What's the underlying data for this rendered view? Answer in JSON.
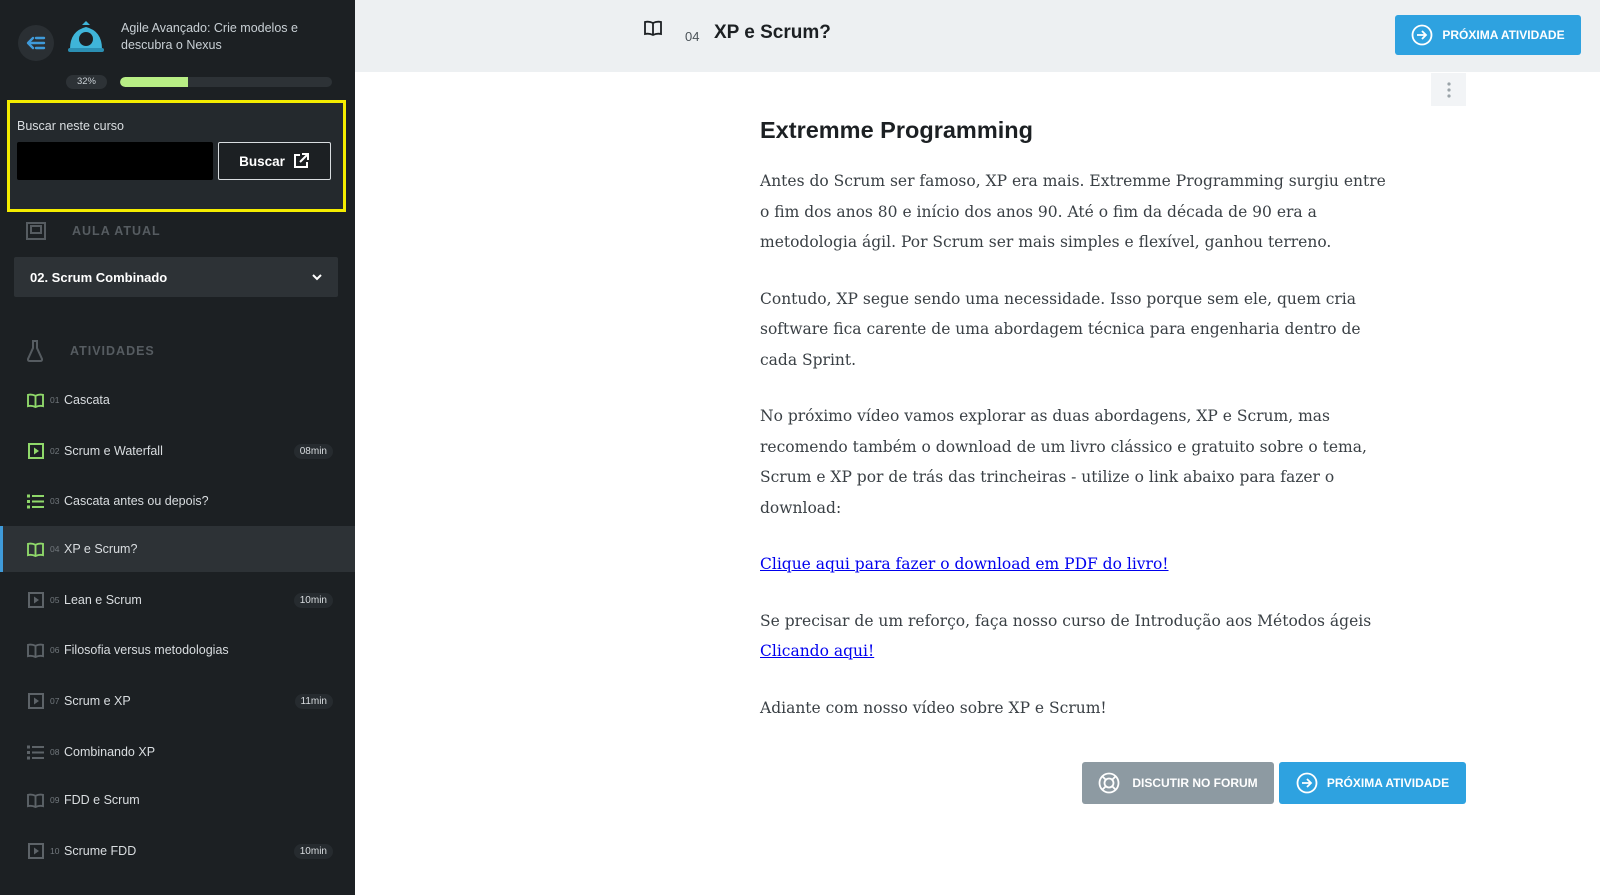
{
  "course": {
    "title": "Agile Avançado: Crie modelos e descubra o Nexus",
    "progress_label": "32%",
    "progress": 0.32
  },
  "search": {
    "label": "Buscar neste curso",
    "placeholder": "",
    "value": "",
    "button_label": "Buscar",
    "highlight_color": "#f4ec00"
  },
  "current_lesson": {
    "heading": "AULA ATUAL",
    "selected": "02. Scrum Combinado"
  },
  "activities": {
    "heading": "ATIVIDADES",
    "items": [
      {
        "num": "01",
        "label": "Cascata",
        "icon": "book-icon",
        "duration": "",
        "done": true
      },
      {
        "num": "02",
        "label": "Scrum e Waterfall",
        "icon": "video-icon",
        "duration": "08min",
        "done": true
      },
      {
        "num": "03",
        "label": "Cascata antes ou depois?",
        "icon": "list-icon",
        "duration": "",
        "done": true
      },
      {
        "num": "04",
        "label": "XP e Scrum?",
        "icon": "book-icon",
        "duration": "",
        "done": true,
        "active": true
      },
      {
        "num": "05",
        "label": "Lean e Scrum",
        "icon": "video-icon",
        "duration": "10min",
        "done": false
      },
      {
        "num": "06",
        "label": "Filosofia versus metodologias",
        "icon": "book-icon",
        "duration": "",
        "done": false
      },
      {
        "num": "07",
        "label": "Scrum e XP",
        "icon": "video-icon",
        "duration": "11min",
        "done": false
      },
      {
        "num": "08",
        "label": "Combinando XP",
        "icon": "list-icon",
        "duration": "",
        "done": false
      },
      {
        "num": "09",
        "label": "FDD e Scrum",
        "icon": "book-icon",
        "duration": "",
        "done": false
      },
      {
        "num": "10",
        "label": "Scrume FDD",
        "icon": "video-icon",
        "duration": "10min",
        "done": false
      }
    ]
  },
  "topbar": {
    "activity_num": "04",
    "activity_title": "XP e Scrum?",
    "next_button": "PRÓXIMA ATIVIDADE"
  },
  "article": {
    "title": "Extremme Programming",
    "p1": "Antes do Scrum ser famoso, XP era mais. Extremme Programming surgiu entre o fim dos anos 80 e início dos anos 90. Até o fim da década de 90 era a metodologia ágil. Por Scrum ser mais simples e flexível, ganhou terreno.",
    "p2": "Contudo, XP segue sendo uma necessidade. Isso porque sem ele, quem cria software fica carente de uma abordagem técnica para engenharia dentro de cada Sprint.",
    "p3": "No próximo vídeo vamos explorar as duas abordagens, XP e Scrum, mas recomendo também o download de um livro clássico e gratuito sobre o tema, Scrum e XP por de trás das trincheiras - utilize o link abaixo para fazer o download:",
    "link_pdf": "Clique aqui para fazer o download em PDF do livro!",
    "p4": "Se precisar de um reforço, faça nosso curso de Introdução aos Métodos ágeis",
    "link_course": "Clicando aqui!",
    "p5": "Adiante com nosso vídeo sobre XP e Scrum!"
  },
  "footer_buttons": {
    "forum": "DISCUTIR NO FORUM",
    "next": "PRÓXIMA ATIVIDADE"
  },
  "colors": {
    "accent": "#2ea2e0",
    "progress": "#b8ee85",
    "done_icon": "#8fd86a",
    "sidebar_bg": "#1c2023"
  }
}
